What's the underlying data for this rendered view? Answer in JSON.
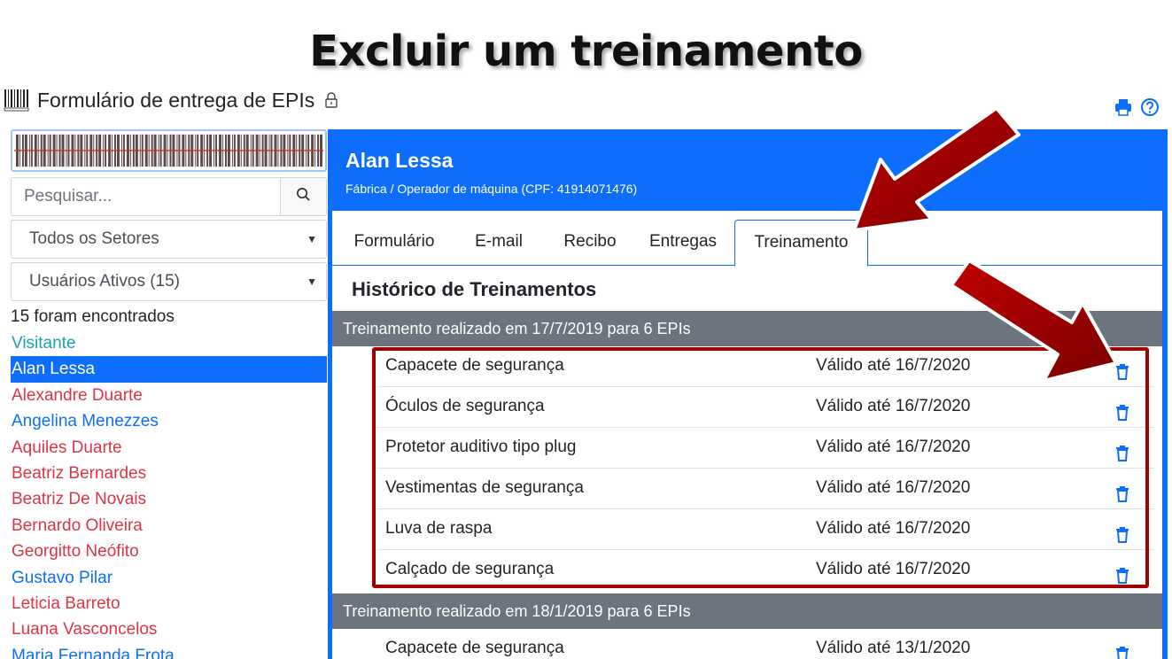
{
  "slide": {
    "title": "Excluir um treinamento"
  },
  "app": {
    "title": "Formulário de entrega de EPIs"
  },
  "sidebar": {
    "search_placeholder": "Pesquisar...",
    "sector_select": "Todos os Setores",
    "users_select": "Usuários Ativos (15)",
    "found_text": "15 foram encontrados",
    "users": [
      {
        "name": "Visitante",
        "color": "#17a2b8"
      },
      {
        "name": "Alan Lessa",
        "color": "#ffffff"
      },
      {
        "name": "Alexandre Duarte",
        "color": "#dc3545"
      },
      {
        "name": "Angelina Menezzes",
        "color": "#0d6efd"
      },
      {
        "name": "Aquiles Duarte",
        "color": "#dc3545"
      },
      {
        "name": "Beatriz Bernardes",
        "color": "#dc3545"
      },
      {
        "name": "Beatriz De Novais",
        "color": "#dc3545"
      },
      {
        "name": "Bernardo Oliveira",
        "color": "#dc3545"
      },
      {
        "name": "Georgitto Neófito",
        "color": "#dc3545"
      },
      {
        "name": "Gustavo Pilar",
        "color": "#0d6efd"
      },
      {
        "name": "Leticia Barreto",
        "color": "#dc3545"
      },
      {
        "name": "Luana Vasconcelos",
        "color": "#dc3545"
      },
      {
        "name": "Maria Fernanda Frota",
        "color": "#0d6efd"
      }
    ]
  },
  "employee": {
    "name": "Alan Lessa",
    "subtitle": "Fábrica / Operador de máquina (CPF: 41914071476)"
  },
  "tabs": [
    "Formulário",
    "E-mail",
    "Recibo",
    "Entregas",
    "Treinamento"
  ],
  "section_title": "Histórico de Treinamentos",
  "trainings": [
    {
      "header": "Treinamento realizado em 17/7/2019 para 6 EPIs",
      "items": [
        {
          "name": "Capacete de segurança",
          "valid": "Válido até 16/7/2020"
        },
        {
          "name": "Óculos de segurança",
          "valid": "Válido até 16/7/2020"
        },
        {
          "name": "Protetor auditivo tipo plug",
          "valid": "Válido até 16/7/2020"
        },
        {
          "name": "Vestimentas de segurança",
          "valid": "Válido até 16/7/2020"
        },
        {
          "name": "Luva de raspa",
          "valid": "Válido até 16/7/2020"
        },
        {
          "name": "Calçado de segurança",
          "valid": "Válido até 16/7/2020"
        }
      ]
    },
    {
      "header": "Treinamento realizado em 18/1/2019 para 6 EPIs",
      "items": [
        {
          "name": "Capacete de segurança",
          "valid": "Válido até 13/1/2020"
        }
      ]
    }
  ],
  "colors": {
    "primary": "#0d6efd",
    "header_gray": "#6c757d",
    "highlight": "#a30000"
  }
}
